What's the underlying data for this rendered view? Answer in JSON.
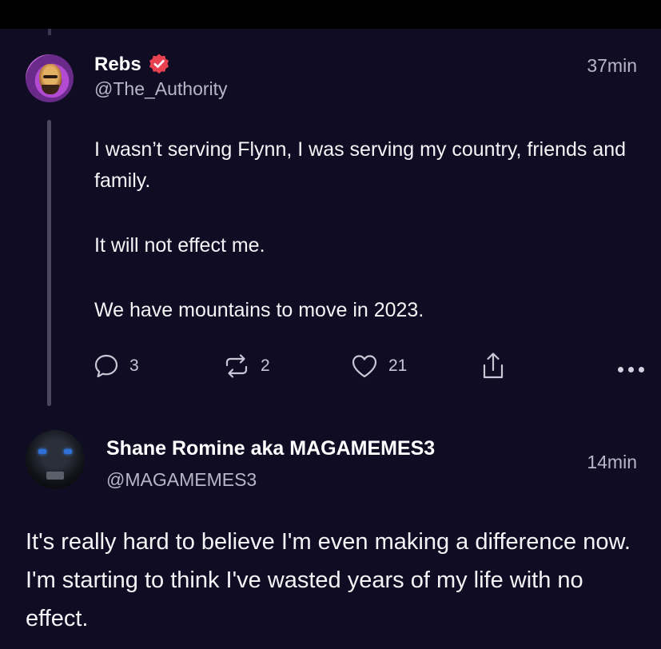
{
  "post1": {
    "author_name": "Rebs",
    "handle": "@The_Authority",
    "time": "37min",
    "verified": true,
    "paragraphs": [
      "I wasn’t serving Flynn, I was serving my country, friends and family.",
      "It will not effect me.",
      "We have mountains to move in 2023."
    ],
    "replies": "3",
    "reposts": "2",
    "likes": "21",
    "icons": {
      "reply": "comment-bubble-icon",
      "repost": "repost-arrows-icon",
      "like": "heart-icon",
      "share": "share-upload-icon",
      "more": "more-dots-icon",
      "verified": "verified-badge-icon"
    }
  },
  "post2": {
    "author_name": "Shane Romine aka MAGAMEMES3",
    "handle": "@MAGAMEMES3",
    "time": "14min",
    "text": "It's really hard to believe I'm even making a difference now. I'm starting to think I've wasted years of my life with no effect."
  },
  "colors": {
    "background": "#100c24",
    "verified_badge": "#e8414f",
    "secondary_text": "#b8b6c6",
    "thread_line": "#4a4860"
  }
}
